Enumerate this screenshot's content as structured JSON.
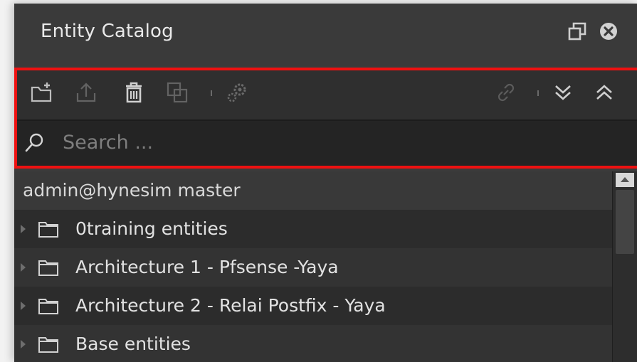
{
  "window": {
    "title": "Entity Catalog"
  },
  "window_controls": {
    "restore": "restore-icon",
    "close": "close-icon"
  },
  "toolbar": {
    "icons": [
      "new-folder-icon",
      "upload-icon",
      "trash-icon",
      "copy-icon",
      "gears-icon",
      "link-icon",
      "expand-all-icon",
      "collapse-all-icon"
    ]
  },
  "search": {
    "placeholder": "Search ..."
  },
  "tree": {
    "header": "admin@hynesim master",
    "items": [
      {
        "label": "0training entities"
      },
      {
        "label": "Architecture 1 - Pfsense -Yaya"
      },
      {
        "label": "Architecture 2 - Relai Postfix - Yaya"
      },
      {
        "label": "Base entities"
      }
    ]
  },
  "colors": {
    "highlight": "#ee1111",
    "panel": "#3b3b3b",
    "search_bg": "#242424"
  }
}
